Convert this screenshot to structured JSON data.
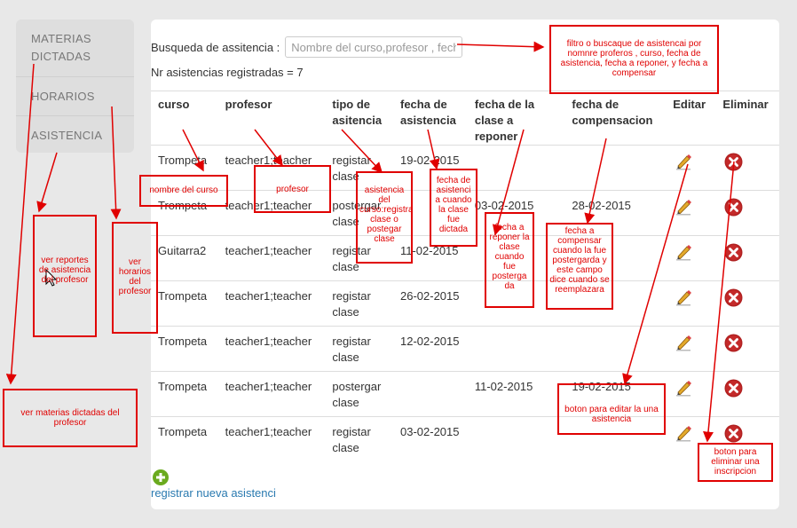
{
  "sidebar": {
    "items": [
      {
        "label": "MATERIAS DICTADAS"
      },
      {
        "label": "HORARIOS"
      },
      {
        "label": "ASISTENCIA"
      }
    ]
  },
  "search": {
    "label": "Busqueda de assitencia :",
    "placeholder": "Nombre del curso,profesor , fech"
  },
  "count_text": "Nr asistencias registradas = 7",
  "table": {
    "headers": {
      "curso": "curso",
      "profesor": "profesor",
      "tipo": "tipo de asitencia",
      "fecha_asistencia": "fecha de asistencia",
      "fecha_reponer": "fecha de la clase a reponer",
      "fecha_comp": "fecha de compensacion",
      "editar": "Editar",
      "eliminar": "Eliminar"
    },
    "rows": [
      {
        "curso": "Trompeta",
        "profesor": "teacher1;teacher",
        "tipo": "registar clase",
        "fecha_asistencia": "19-02-2015",
        "fecha_reponer": "",
        "fecha_comp": ""
      },
      {
        "curso": "Trompeta",
        "profesor": "teacher1;teacher",
        "tipo": "postergar clase",
        "fecha_asistencia": "",
        "fecha_reponer": "03-02-2015",
        "fecha_comp": "28-02-2015"
      },
      {
        "curso": "Guitarra2",
        "profesor": "teacher1;teacher",
        "tipo": "registar clase",
        "fecha_asistencia": "11-02-2015",
        "fecha_reponer": "",
        "fecha_comp": ""
      },
      {
        "curso": "Trompeta",
        "profesor": "teacher1;teacher",
        "tipo": "registar clase",
        "fecha_asistencia": "26-02-2015",
        "fecha_reponer": "",
        "fecha_comp": ""
      },
      {
        "curso": "Trompeta",
        "profesor": "teacher1;teacher",
        "tipo": "registar clase",
        "fecha_asistencia": "12-02-2015",
        "fecha_reponer": "",
        "fecha_comp": ""
      },
      {
        "curso": "Trompeta",
        "profesor": "teacher1;teacher",
        "tipo": "postergar clase",
        "fecha_asistencia": "",
        "fecha_reponer": "11-02-2015",
        "fecha_comp": "19-02-2015"
      },
      {
        "curso": "Trompeta",
        "profesor": "teacher1;teacher",
        "tipo": "registar clase",
        "fecha_asistencia": "03-02-2015",
        "fecha_reponer": "",
        "fecha_comp": ""
      }
    ],
    "edit_icon": "pencil-icon",
    "delete_icon": "delete-circle-icon"
  },
  "add": {
    "icon": "plus-circle-icon",
    "label": "registrar nueva asistenci"
  },
  "annotations": {
    "filtro": "filtro o buscaque de asistencai por nomnre proferos , curso, fecha de asistencia, fecha a reponer, y fecha a compensar",
    "nombre_curso": "nombre del curso",
    "profesor": "profesor",
    "tipo": "asistencia del curso:registrar clase o postegar clase",
    "fecha_asistencia": "fecha de asistenci a cuando la clase fue dictada",
    "fecha_reponer": "fecha a reponer la clase cuando fue posterga da",
    "fecha_comp": "fecha a compensar cuando la fue postergarda y este campo dice cuando se reemplazara",
    "reportes": "ver reportes de asistencia del profesor",
    "horarios": "ver horarios del profesor",
    "materias": "ver materias dictadas del profesor",
    "editar": "boton para editar la una asistencia",
    "eliminar": "boton para eliminar una inscripcion"
  },
  "colors": {
    "annotation": "#e00000",
    "link": "#2a7ab0",
    "delete": "#b02020",
    "add": "#6aaa1e"
  }
}
